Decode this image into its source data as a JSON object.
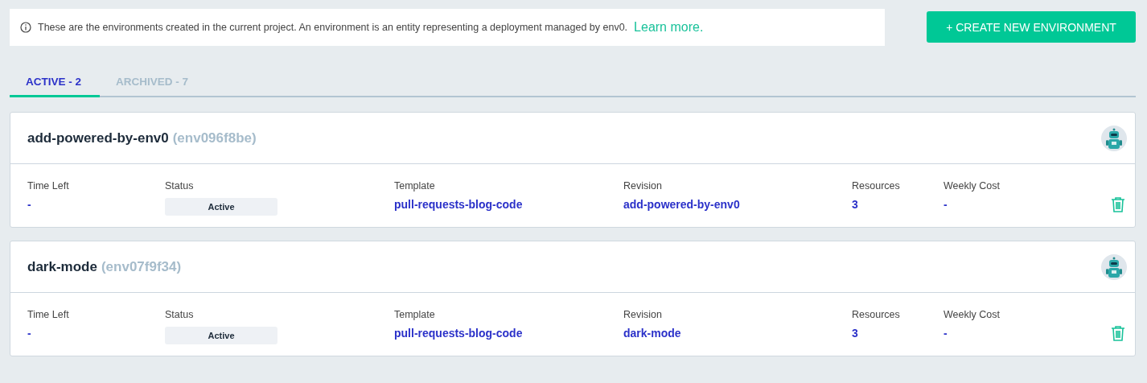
{
  "info_banner": {
    "text": "These are the environments created in the current project. An environment is an entity representing a deployment managed by env0.",
    "link": "Learn more."
  },
  "create_button": "+ CREATE NEW ENVIRONMENT",
  "tabs": [
    {
      "label": "ACTIVE - 2",
      "selected": true
    },
    {
      "label": "ARCHIVED - 7",
      "selected": false
    }
  ],
  "environments": [
    {
      "name": "add-powered-by-env0",
      "id": "(env096f8be)",
      "details": [
        {
          "kind": "value",
          "label": "Time Left",
          "value": "-"
        },
        {
          "kind": "badge",
          "label": "Status",
          "value": "Active"
        },
        {
          "kind": "value",
          "label": "Template",
          "value": "pull-requests-blog-code"
        },
        {
          "kind": "value",
          "label": "Revision",
          "value": "add-powered-by-env0"
        },
        {
          "kind": "value",
          "label": "Resources",
          "value": "3"
        },
        {
          "kind": "value",
          "label": "Weekly Cost",
          "value": "-"
        }
      ]
    },
    {
      "name": "dark-mode",
      "id": "(env07f9f34)",
      "details": [
        {
          "kind": "value",
          "label": "Time Left",
          "value": "-"
        },
        {
          "kind": "badge",
          "label": "Status",
          "value": "Active"
        },
        {
          "kind": "value",
          "label": "Template",
          "value": "pull-requests-blog-code"
        },
        {
          "kind": "value",
          "label": "Revision",
          "value": "dark-mode"
        },
        {
          "kind": "value",
          "label": "Resources",
          "value": "3"
        },
        {
          "kind": "value",
          "label": "Weekly Cost",
          "value": "-"
        }
      ]
    }
  ]
}
